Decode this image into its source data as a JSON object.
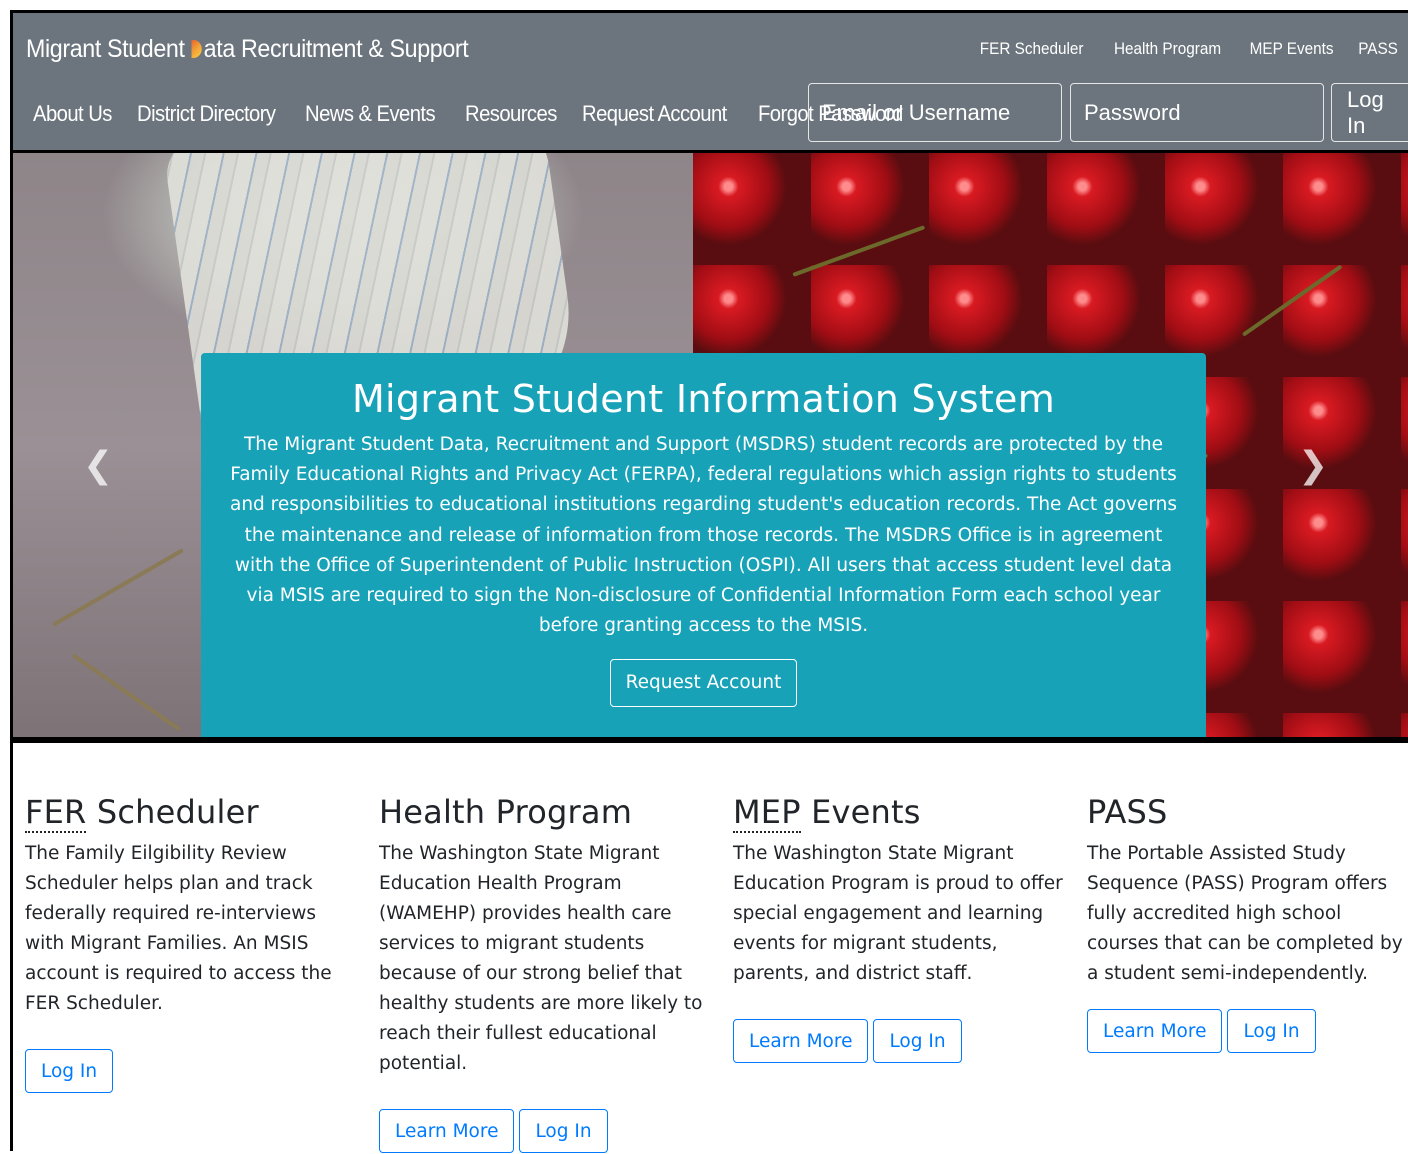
{
  "brand": {
    "prefix": "Migrant Student ",
    "suffix": "ata Recruitment & Support"
  },
  "toplinks": [
    "FER Scheduler",
    "Health Program",
    "MEP Events",
    "PASS"
  ],
  "nav": [
    "About Us",
    "District Directory",
    "News & Events",
    "Resources",
    "Request Account",
    "Forgot Password"
  ],
  "login": {
    "email_placeholder": "Email or Username",
    "password_placeholder": "Password",
    "button": "Log In"
  },
  "hero": {
    "title": "Migrant Student Information System",
    "body": "The Migrant Student Data, Recruitment and Support (MSDRS) student records are protected by the Family Educational Rights and Privacy Act (FERPA), federal regulations which assign rights to students and responsibilities to educational institutions regarding student's education records. The Act governs the maintenance and release of information from those records. The MSDRS Office is in agreement with the Office of Superintendent of Public Instruction (OSPI). All users that access student level data via MSIS are required to sign the Non-disclosure of Confidential Information Form each school year before granting access to the MSIS.",
    "button": "Request Account",
    "prev_icon": "chevron-left-icon",
    "next_icon": "chevron-right-icon"
  },
  "cards": {
    "fer": {
      "abbr": "FER",
      "title_rest": " Scheduler",
      "text": "The Family Eilgibility Review Scheduler helps plan and track federally required re-interviews with Migrant Families. An MSIS account is required to access the FER Scheduler.",
      "login": "Log In"
    },
    "health": {
      "title": "Health Program",
      "text": "The Washington State Migrant Education Health Program (WAMEHP) provides health care services to migrant students because of our strong belief that healthy students are more likely to reach their fullest educational potential.",
      "learn": "Learn More",
      "login": "Log In"
    },
    "mep": {
      "abbr": "MEP",
      "title_rest": " Events",
      "text": "The Washington State Migrant Education Program is proud to offer special engagement and learning events for migrant students, parents, and district staff.",
      "learn": "Learn More",
      "login": "Log In"
    },
    "pass": {
      "title": "PASS",
      "text": "The Portable Assisted Study Sequence (PASS) Program offers fully accredited high school courses that can be completed by a student semi-independently.",
      "learn": "Learn More",
      "login": "Log In"
    }
  },
  "colors": {
    "navbar": "#6c757d",
    "caption": "#17a2b8",
    "primary": "#007bff"
  }
}
